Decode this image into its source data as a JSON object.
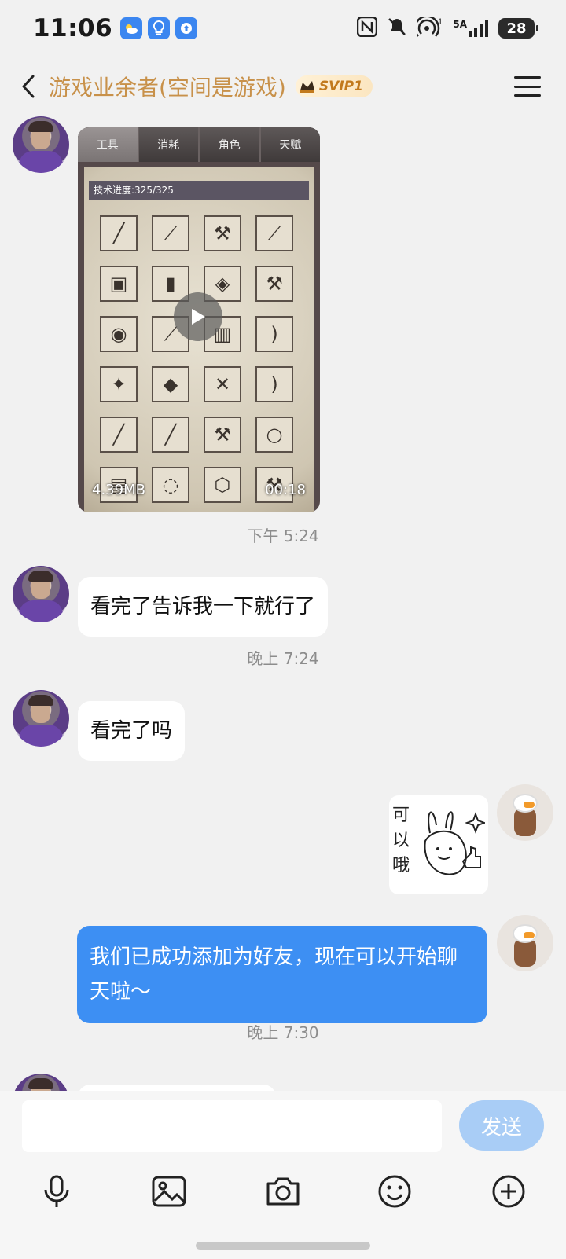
{
  "status_bar": {
    "time": "11:06",
    "app_icons": [
      "weather-icon",
      "lightbulb-icon",
      "upload-icon"
    ],
    "network": "5A",
    "battery": "28",
    "icons": [
      "nfc-icon",
      "mute-bell-icon",
      "hotspot-icon",
      "signal-icon",
      "battery-icon"
    ]
  },
  "header": {
    "title": "游戏业余者(空间是游戏)",
    "badge": "SVIP1",
    "title_color": "#c8914a"
  },
  "messages": {
    "video": {
      "tabs": [
        "工具",
        "消耗",
        "角色",
        "天赋"
      ],
      "progress_text": "技术进度:325/325",
      "size": "4.39MB",
      "duration": "00:18"
    },
    "time1": "下午 5:24",
    "msg1": "看完了告诉我一下就行了",
    "time2": "晚上 7:24",
    "msg2": "看完了吗",
    "sticker_text": "可\n以\n哦",
    "msg3": "我们已成功添加为好友，现在可以开始聊天啦～",
    "time3": "晚上 7:30"
  },
  "input_bar": {
    "placeholder": "",
    "send_label": "发送",
    "send_color": "#a9cdf6",
    "tools": [
      "microphone-icon",
      "image-icon",
      "camera-icon",
      "emoji-icon",
      "plus-icon"
    ]
  },
  "colors": {
    "blue_bubble": "#3d8ff3",
    "background": "#f1f1f1"
  }
}
